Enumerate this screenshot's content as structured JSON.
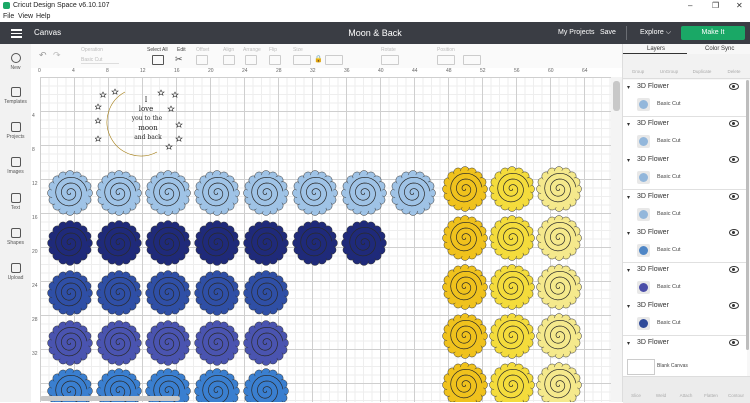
{
  "window": {
    "title": "Cricut Design Space  v6.10.107",
    "controls": [
      "–",
      "❐",
      "✕"
    ]
  },
  "menu": [
    "File",
    "View",
    "Help"
  ],
  "header": {
    "section": "Canvas",
    "project_title": "Moon & Back",
    "my_projects": "My Projects",
    "save": "Save",
    "explore": "Explore",
    "make_it": "Make It"
  },
  "toolbar": {
    "operation_label": "Operation",
    "operation_value": "Basic Cut",
    "select_all": "Select All",
    "edit": "Edit",
    "offset": "Offset",
    "align": "Align",
    "arrange": "Arrange",
    "flip": "Flip",
    "size": "Size",
    "rotate": "Rotate",
    "position": "Position"
  },
  "sidebar": {
    "items": [
      {
        "label": "New",
        "icon": "plus-icon"
      },
      {
        "label": "Templates",
        "icon": "shirt-icon"
      },
      {
        "label": "Projects",
        "icon": "projects-icon"
      },
      {
        "label": "Images",
        "icon": "image-icon"
      },
      {
        "label": "Text",
        "icon": "text-icon"
      },
      {
        "label": "Shapes",
        "icon": "shapes-icon"
      },
      {
        "label": "Upload",
        "icon": "upload-icon"
      }
    ]
  },
  "ruler": {
    "top": [
      "0",
      "4",
      "8",
      "12",
      "16",
      "20",
      "24",
      "28",
      "32",
      "36",
      "40",
      "44",
      "48",
      "52",
      "56",
      "60",
      "64"
    ],
    "left": [
      "4",
      "8",
      "12",
      "16",
      "20",
      "24",
      "28",
      "32"
    ]
  },
  "panel": {
    "tabs": [
      "Layers",
      "Color Sync"
    ],
    "top_tools": [
      "Group",
      "UnGroup",
      "Duplicate",
      "Delete"
    ],
    "layers": [
      {
        "name": "3D Flower",
        "cut": "Basic Cut",
        "color": "#93b7db"
      },
      {
        "name": "3D Flower",
        "cut": "Basic Cut",
        "color": "#93b7db"
      },
      {
        "name": "3D Flower",
        "cut": "Basic Cut",
        "color": "#93b7db"
      },
      {
        "name": "3D Flower",
        "cut": "Basic Cut",
        "color": "#93b7db"
      },
      {
        "name": "3D Flower",
        "cut": "Basic Cut",
        "color": "#4f86c6"
      },
      {
        "name": "3D Flower",
        "cut": "Basic Cut",
        "color": "#4b4ea8"
      },
      {
        "name": "3D Flower",
        "cut": "Basic Cut",
        "color": "#2f4a99"
      },
      {
        "name": "3D Flower",
        "cut": "",
        "color": ""
      }
    ],
    "blank_canvas": "Blank Canvas",
    "bottom_tools": [
      "Slice",
      "Weld",
      "Attach",
      "Flatten",
      "Contour"
    ]
  },
  "canvas": {
    "moon_text": [
      "I",
      "love",
      "you to the",
      "moon",
      "and back"
    ],
    "colors": {
      "light_blue": "#9fc3e6",
      "navy": "#1f2a7a",
      "royal": "#2f4fa6",
      "indigo": "#4a54b0",
      "bright_blue": "#3a7fd0",
      "gold": "#f0c21d",
      "yellow": "#f4dc3c",
      "pale_yellow": "#f5e98c",
      "moon": "#f6b921"
    }
  }
}
